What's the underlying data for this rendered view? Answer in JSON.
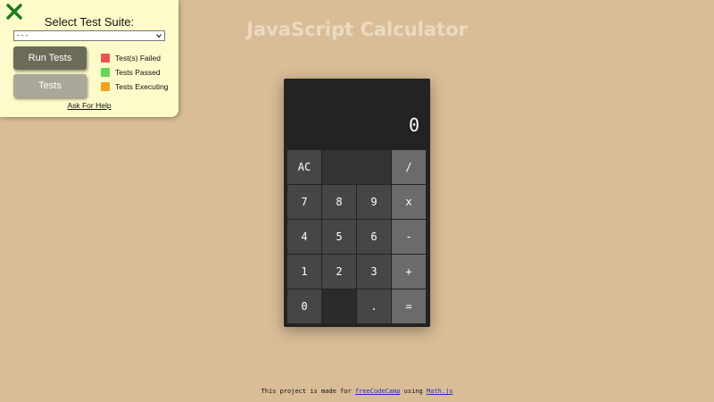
{
  "test_panel": {
    "title": "Select Test Suite:",
    "select_value": "- - -",
    "run_tests_label": "Run Tests",
    "tests_label": "Tests",
    "legend": [
      {
        "label": "Test(s) Failed",
        "color": "#e9564b"
      },
      {
        "label": "Tests Passed",
        "color": "#6ad35a"
      },
      {
        "label": "Tests Executing",
        "color": "#f3a21d"
      }
    ],
    "help_label": "Ask For Help",
    "close_icon": "close-x-icon",
    "close_color": "#1e7a1e"
  },
  "page": {
    "title": "JavaScript Calculator"
  },
  "calculator": {
    "display": "0",
    "keys": {
      "clear": "AC",
      "divide": "/",
      "seven": "7",
      "eight": "8",
      "nine": "9",
      "multiply": "x",
      "four": "4",
      "five": "5",
      "six": "6",
      "subtract": "-",
      "one": "1",
      "two": "2",
      "three": "3",
      "add": "+",
      "zero": "0",
      "decimal": ".",
      "equals": "="
    }
  },
  "footer": {
    "prefix": "This project is made for ",
    "link1": "freeCodeCamp",
    "middle": " using ",
    "link2": "Math.js"
  }
}
